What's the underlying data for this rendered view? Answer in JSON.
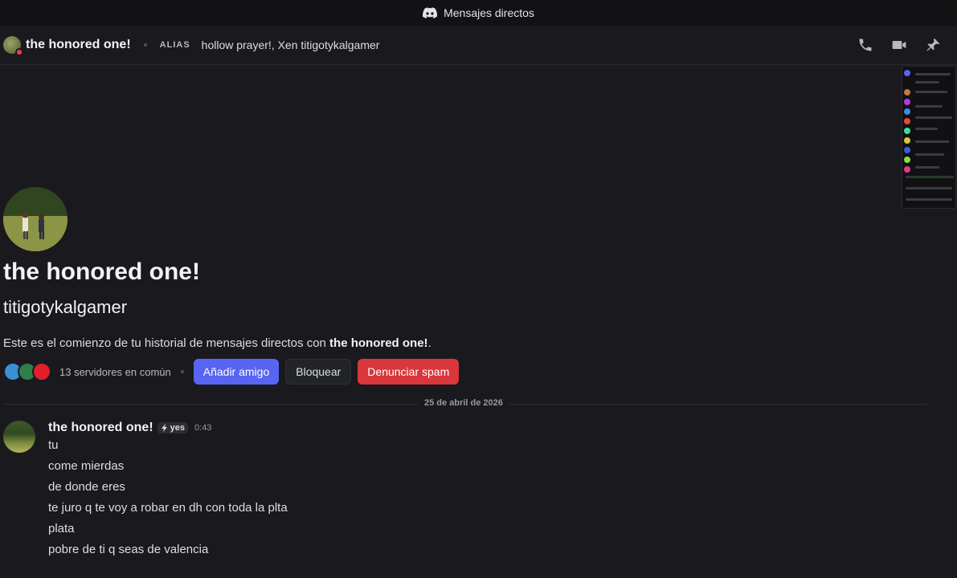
{
  "titlebar": {
    "title": "Mensajes directos",
    "icon": "discord-logo-icon"
  },
  "header": {
    "name": "the honored one!",
    "alias_label": "ALIAS",
    "alias_value": "hollow prayer!, Xen titigotykalgamer",
    "actions": [
      "phone-call-icon",
      "video-call-icon",
      "pin-icon"
    ]
  },
  "profile": {
    "display_name": "the honored one!",
    "username": "titigotykalgamer",
    "intro_prefix": "Este es el comienzo de tu historial de mensajes directos con",
    "intro_name": "the honored one!",
    "intro_suffix": ".",
    "mutual_servers": "13 servidores en común",
    "buttons": {
      "add_friend": "Añadir amigo",
      "block": "Bloquear",
      "report": "Denunciar spam"
    }
  },
  "divider": {
    "date": "25 de abril de 2026"
  },
  "message": {
    "author": "the honored one!",
    "tag": "yes",
    "time": "0:43",
    "lines": [
      "tu",
      "come mierdas",
      "de donde eres",
      "te juro q te voy a robar en dh con toda la plta",
      "plata",
      "pobre de ti q seas de valencia"
    ]
  },
  "colors": {
    "accent": "#5865f2",
    "danger": "#da373c",
    "background": "#1a1a1e",
    "status_dnd": "#f23f43"
  }
}
